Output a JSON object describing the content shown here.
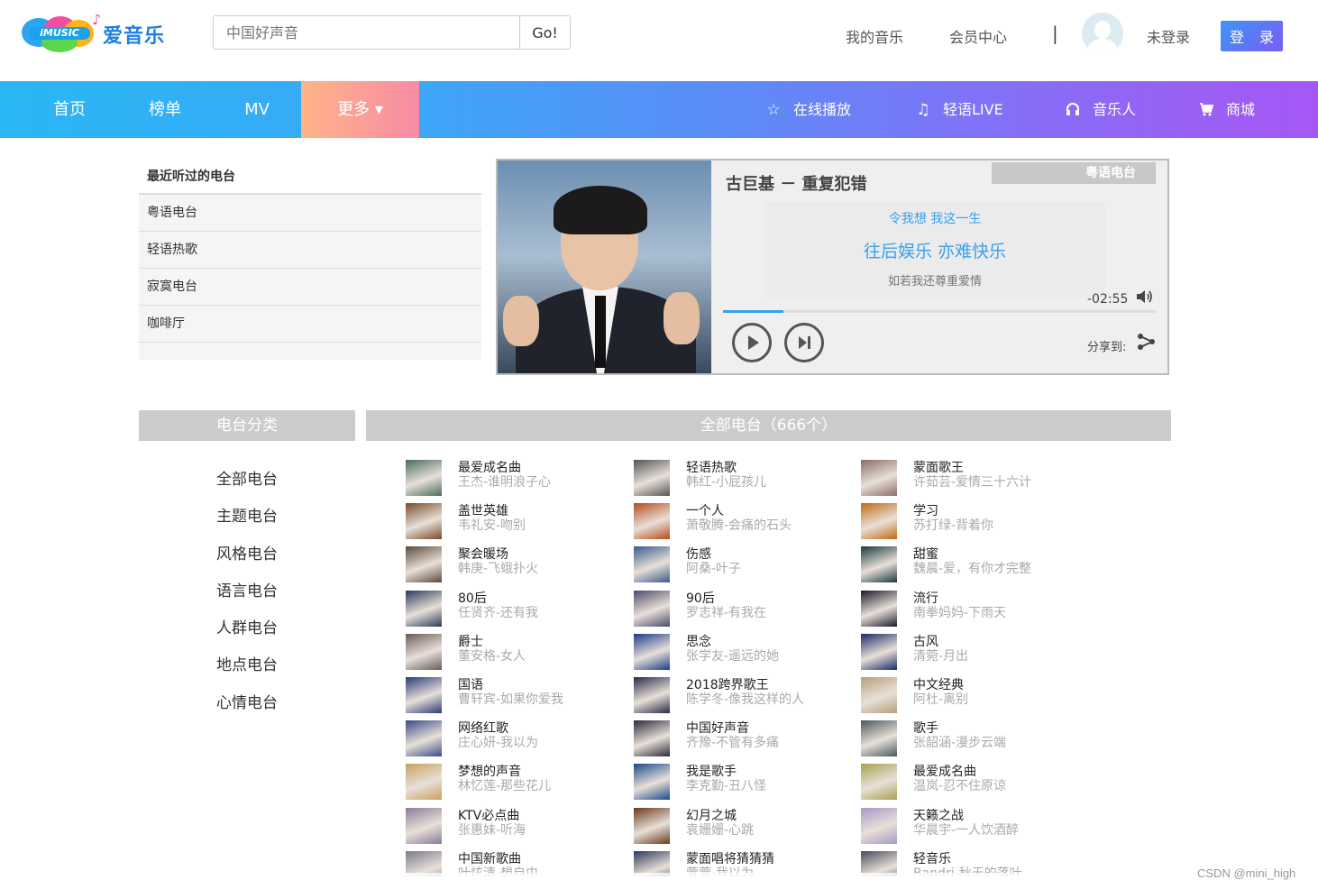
{
  "header": {
    "brand_tag": "iMUSIC",
    "brand_name": "爱音乐",
    "search_placeholder": "中国好声音",
    "go_label": "Go!",
    "my_music": "我的音乐",
    "member_center": "会员中心",
    "separator": "|",
    "not_logged_in": "未登录",
    "login_label": "登 录"
  },
  "nav": {
    "items": [
      "首页",
      "榜单",
      "MV",
      "更多 ▾"
    ],
    "right": [
      {
        "label": "在线播放",
        "icon": "star-icon"
      },
      {
        "label": "轻语LIVE",
        "icon": "music-note-icon"
      },
      {
        "label": "音乐人",
        "icon": "headphones-icon"
      },
      {
        "label": "商城",
        "icon": "cart-icon"
      }
    ]
  },
  "recent": {
    "title": "最近听过的电台",
    "items": [
      "粤语电台",
      "轻语热歌",
      "寂寞电台",
      "咖啡厅"
    ]
  },
  "player": {
    "song": "古巨基 － 重复犯错",
    "channel": "粤语电台",
    "lyrics": [
      "令我想 我这一生",
      "往后娱乐 亦难快乐",
      "如若我还尊重爱情"
    ],
    "time": "-02:55",
    "share_label": "分享到:",
    "progress": 0.14
  },
  "categories": {
    "title": "电台分类",
    "items": [
      "全部电台",
      "主题电台",
      "风格电台",
      "语言电台",
      "人群电台",
      "地点电台",
      "心情电台"
    ]
  },
  "all": {
    "title": "全部电台（666个）",
    "stations": [
      {
        "name": "最爱成名曲",
        "sub": "王杰-谁明浪子心",
        "color": "#4a6a5a"
      },
      {
        "name": "轻语热歌",
        "sub": "韩红-小屁孩儿",
        "color": "#555555"
      },
      {
        "name": "蒙面歌王",
        "sub": "许茹芸-爱情三十六计",
        "color": "#8a6c66"
      },
      {
        "name": "盖世英雄",
        "sub": "韦礼安-吻别",
        "color": "#7a4a2a"
      },
      {
        "name": "一个人",
        "sub": "萧敬腾-会痛的石头",
        "color": "#b84a1a"
      },
      {
        "name": "学习",
        "sub": "苏打绿-背着你",
        "color": "#c06a10"
      },
      {
        "name": "聚会暖场",
        "sub": "韩庚-飞蛾扑火",
        "color": "#5a4a3a"
      },
      {
        "name": "伤感",
        "sub": "阿桑-叶子",
        "color": "#3a5a8a"
      },
      {
        "name": "甜蜜",
        "sub": "魏晨-爱，有你才完整",
        "color": "#1a3a3a"
      },
      {
        "name": "80后",
        "sub": "任贤齐-还有我",
        "color": "#2a3a5a"
      },
      {
        "name": "90后",
        "sub": "罗志祥-有我在",
        "color": "#4a4a6a"
      },
      {
        "name": "流行",
        "sub": "南拳妈妈-下雨天",
        "color": "#1a1a2a"
      },
      {
        "name": "爵士",
        "sub": "董安格-女人",
        "color": "#6a5a5a"
      },
      {
        "name": "思念",
        "sub": "张学友-遥远的她",
        "color": "#1a3a8a"
      },
      {
        "name": "古风",
        "sub": "清菀-月出",
        "color": "#1a2a6a"
      },
      {
        "name": "国语",
        "sub": "曹轩宾-如果你爱我",
        "color": "#2a3a7a"
      },
      {
        "name": "2018跨界歌王",
        "sub": "陈学冬-像我这样的人",
        "color": "#2a2a4a"
      },
      {
        "name": "中文经典",
        "sub": "阿杜-离别",
        "color": "#b8a07a"
      },
      {
        "name": "网络红歌",
        "sub": "庄心妍-我以为",
        "color": "#3a4a8a"
      },
      {
        "name": "中国好声音",
        "sub": "齐豫-不管有多痛",
        "color": "#2a2a3a"
      },
      {
        "name": "歌手",
        "sub": "张韶涵-漫步云端",
        "color": "#4a5a5a"
      },
      {
        "name": "梦想的声音",
        "sub": "林忆莲-那些花儿",
        "color": "#c8a060"
      },
      {
        "name": "我是歌手",
        "sub": "李克勤-丑八怪",
        "color": "#1a4a8a"
      },
      {
        "name": "最爱成名曲",
        "sub": "温岚-忍不住原谅",
        "color": "#a8a050"
      },
      {
        "name": "KTV必点曲",
        "sub": "张惠妹-听海",
        "color": "#8a7a9a"
      },
      {
        "name": "幻月之城",
        "sub": "袁姗姗-心跳",
        "color": "#6a3a1a"
      },
      {
        "name": "天籁之战",
        "sub": "华晨宇-一人饮酒醉",
        "color": "#a898c8"
      },
      {
        "name": "中国新歌曲",
        "sub": "叶炫清-想自由",
        "color": "#7a7a8a"
      },
      {
        "name": "蒙面唱将猜猜猜",
        "sub": "萱萱-我以为",
        "color": "#2a3a5a"
      },
      {
        "name": "轻音乐",
        "sub": "Bandri-秋天的落叶",
        "color": "#4a4a5a"
      }
    ]
  },
  "watermark": "CSDN @mini_high"
}
